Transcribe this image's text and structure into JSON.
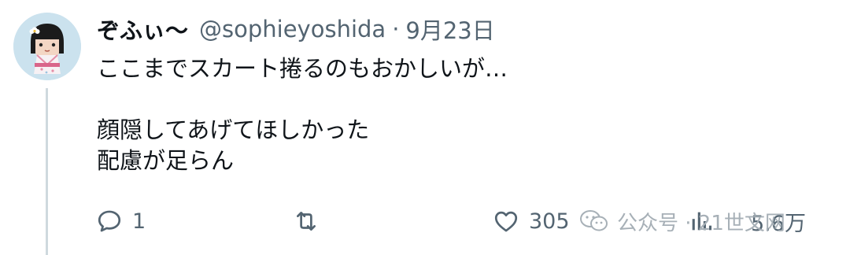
{
  "tweet": {
    "author": {
      "display_name": "ぞふぃ〜",
      "handle": "@sophieyoshida",
      "separator": "·",
      "date": "9月23日",
      "avatar_icon": "character-avatar"
    },
    "text_lines": [
      "ここまでスカート捲るのもおかしいが…",
      "",
      "顔隠してあげてほしかった",
      "配慮が足らん"
    ],
    "actions": {
      "reply": {
        "icon": "reply-icon",
        "count": "1"
      },
      "retweet": {
        "icon": "retweet-icon",
        "count": ""
      },
      "like": {
        "icon": "heart-icon",
        "count": "305"
      },
      "views": {
        "icon": "views-icon",
        "count": "5.6万"
      }
    }
  },
  "watermark": {
    "icon": "wechat-icon",
    "text": "公众号 · 21世文网"
  },
  "colors": {
    "text_primary": "#0f1419",
    "text_secondary": "#536471",
    "thread_line": "#cfd9de",
    "avatar_bg": "#cbe2ee"
  }
}
